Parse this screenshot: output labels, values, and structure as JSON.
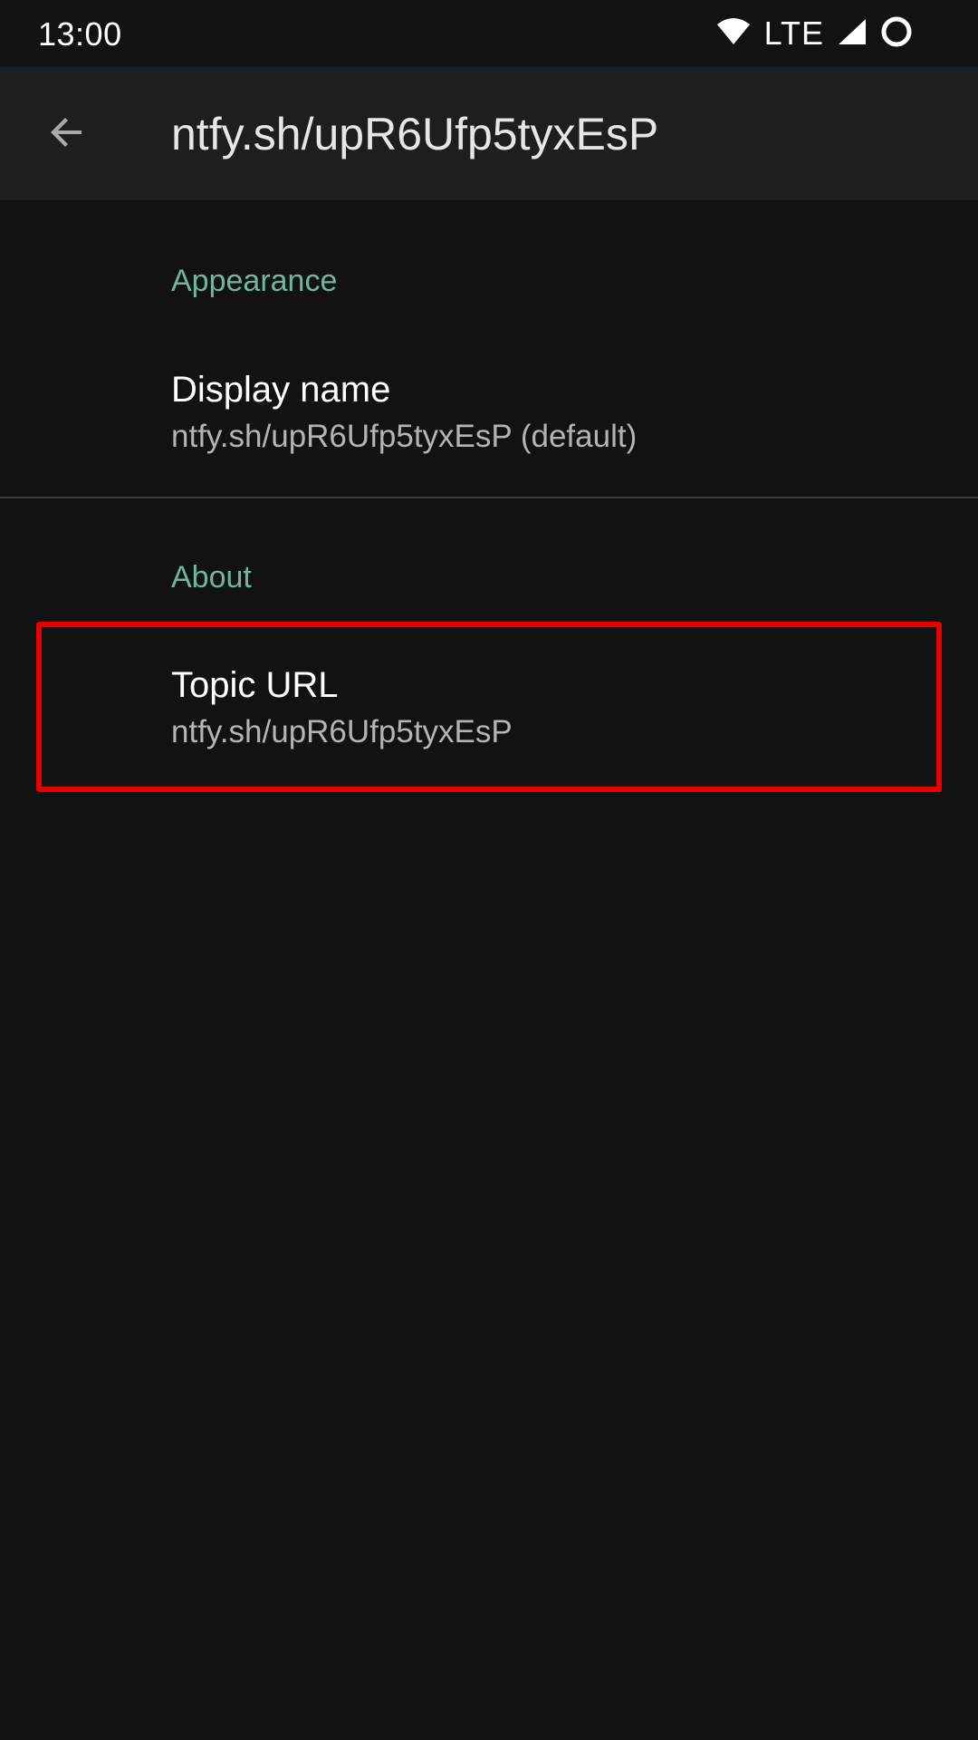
{
  "status_bar": {
    "time": "13:00",
    "network_label": "LTE",
    "icons": [
      "wifi-icon",
      "signal-icon",
      "circle-icon"
    ]
  },
  "app_bar": {
    "back_icon": "arrow-back-icon",
    "title": "ntfy.sh/upR6Ufp5tyxEsP"
  },
  "sections": [
    {
      "header": "Appearance",
      "items": [
        {
          "title": "Display name",
          "summary": "ntfy.sh/upR6Ufp5tyxEsP (default)"
        }
      ]
    },
    {
      "header": "About",
      "items": [
        {
          "title": "Topic URL",
          "summary": "ntfy.sh/upR6Ufp5tyxEsP"
        }
      ]
    }
  ],
  "colors": {
    "background": "#121212",
    "app_bar": "#1b1f22",
    "accent": "#6fb5a0",
    "highlight": "#e60000"
  }
}
